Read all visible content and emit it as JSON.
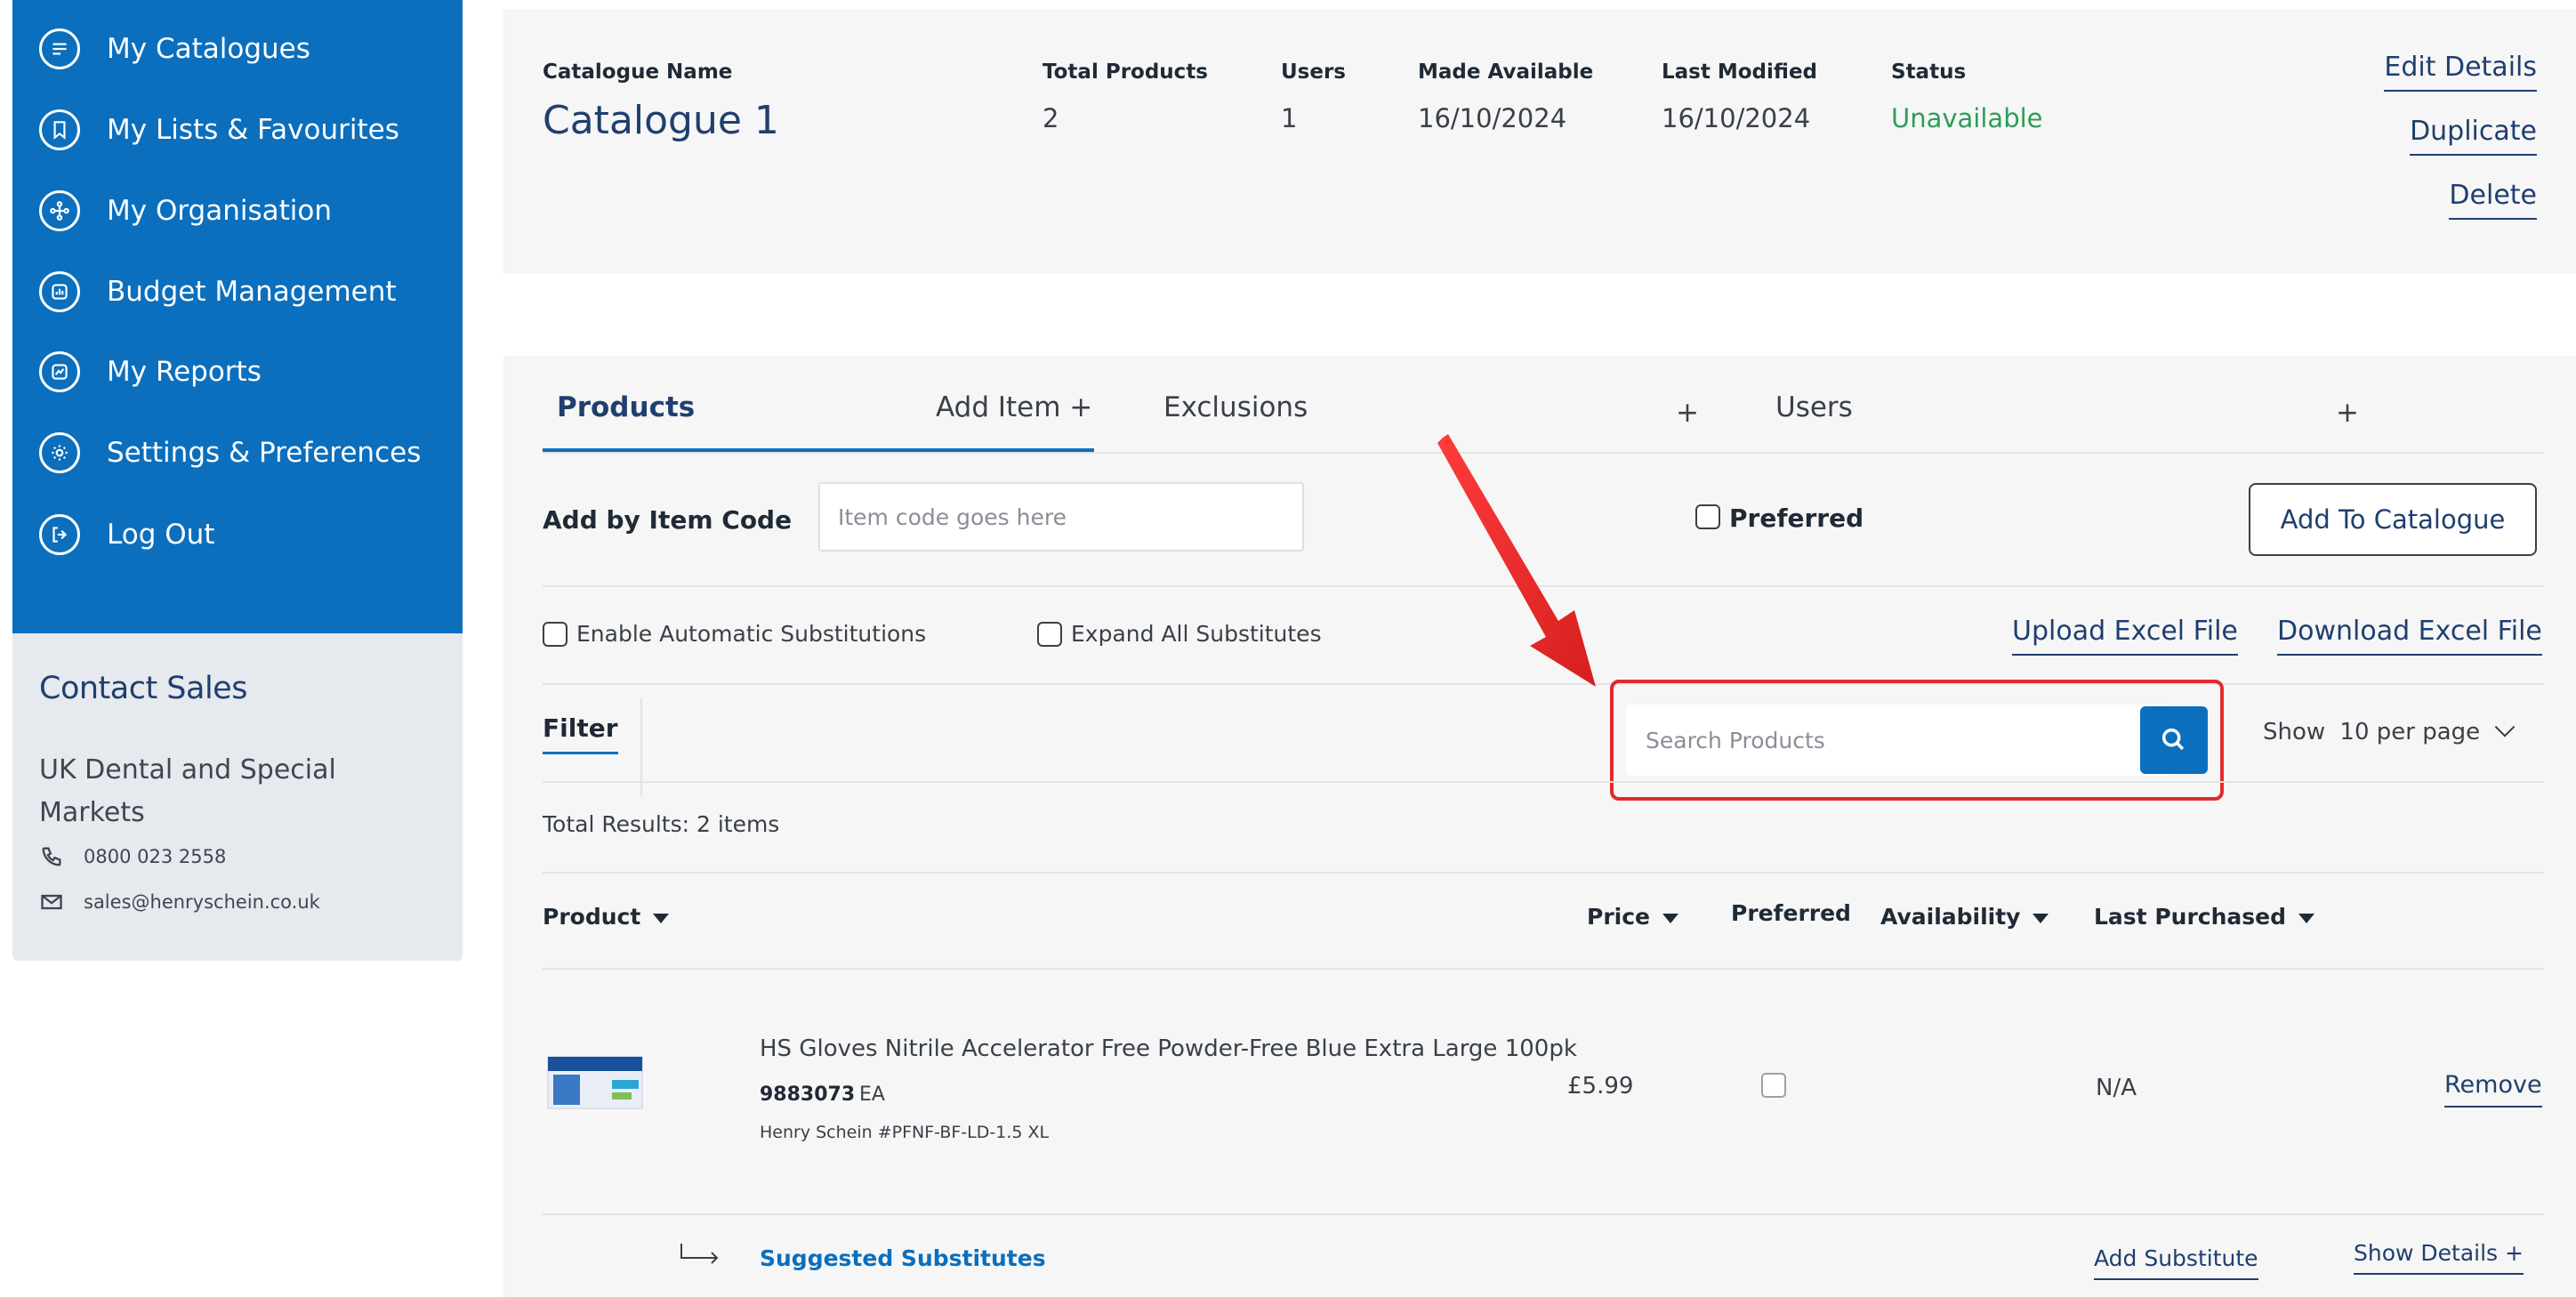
{
  "sidebar": {
    "items": [
      {
        "label": "My Catalogues",
        "icon": "list-icon"
      },
      {
        "label": "My Lists & Favourites",
        "icon": "bookmark-icon"
      },
      {
        "label": "My Organisation",
        "icon": "org-chart-icon"
      },
      {
        "label": "Budget Management",
        "icon": "bar-chart-icon"
      },
      {
        "label": "My Reports",
        "icon": "line-chart-icon"
      },
      {
        "label": "Settings & Preferences",
        "icon": "gear-icon"
      },
      {
        "label": "Log Out",
        "icon": "logout-icon"
      }
    ],
    "contact": {
      "title": "Contact Sales",
      "text": "UK Dental and Special Markets",
      "phone": "0800 023 2558",
      "email": "sales@henryschein.co.uk"
    }
  },
  "catalogue": {
    "headers": {
      "name": "Catalogue Name",
      "total_products": "Total Products",
      "users": "Users",
      "made_available": "Made Available",
      "last_modified": "Last Modified",
      "status": "Status"
    },
    "values": {
      "name": "Catalogue 1",
      "total_products": "2",
      "users": "1",
      "made_available": "16/10/2024",
      "last_modified": "16/10/2024",
      "status": "Unavailable"
    },
    "actions": {
      "edit": "Edit Details",
      "duplicate": "Duplicate",
      "delete": "Delete"
    }
  },
  "tabs": {
    "products": "Products",
    "add_item": "Add Item +",
    "exclusions": "Exclusions",
    "exclusions_plus": "+",
    "users": "Users",
    "users_plus": "+"
  },
  "add_item": {
    "label": "Add by Item Code",
    "placeholder": "Item code goes here",
    "preferred": "Preferred",
    "button": "Add To Catalogue"
  },
  "options": {
    "auto_sub": "Enable Automatic Substitutions",
    "expand_sub": "Expand All Substitutes",
    "upload": "Upload Excel File",
    "download": "Download Excel File"
  },
  "filter": {
    "label": "Filter",
    "search_placeholder": "Search Products",
    "show": "Show",
    "per_page": "10 per page"
  },
  "results": {
    "total": "Total Results: 2 items"
  },
  "table": {
    "headers": {
      "product": "Product",
      "price": "Price",
      "preferred": "Preferred",
      "availability": "Availability",
      "last_purchased": "Last Purchased"
    },
    "rows": [
      {
        "name": "HS Gloves Nitrile Accelerator Free Powder-Free Blue Extra Large 100pk",
        "code": "9883073",
        "unit": "EA",
        "manufacturer": "Henry Schein #PFNF-BF-LD-1.5 XL",
        "price": "£5.99",
        "last_purchased": "N/A",
        "action": "Remove",
        "substitutes_label": "Suggested Substitutes",
        "add_substitute": "Add Substitute",
        "show_details": "Show Details +"
      }
    ]
  },
  "colors": {
    "brand_blue": "#0b6fbd",
    "navy": "#1f3f6e",
    "status_unavailable": "#2e9e58",
    "highlight_red": "#e32a2a"
  }
}
